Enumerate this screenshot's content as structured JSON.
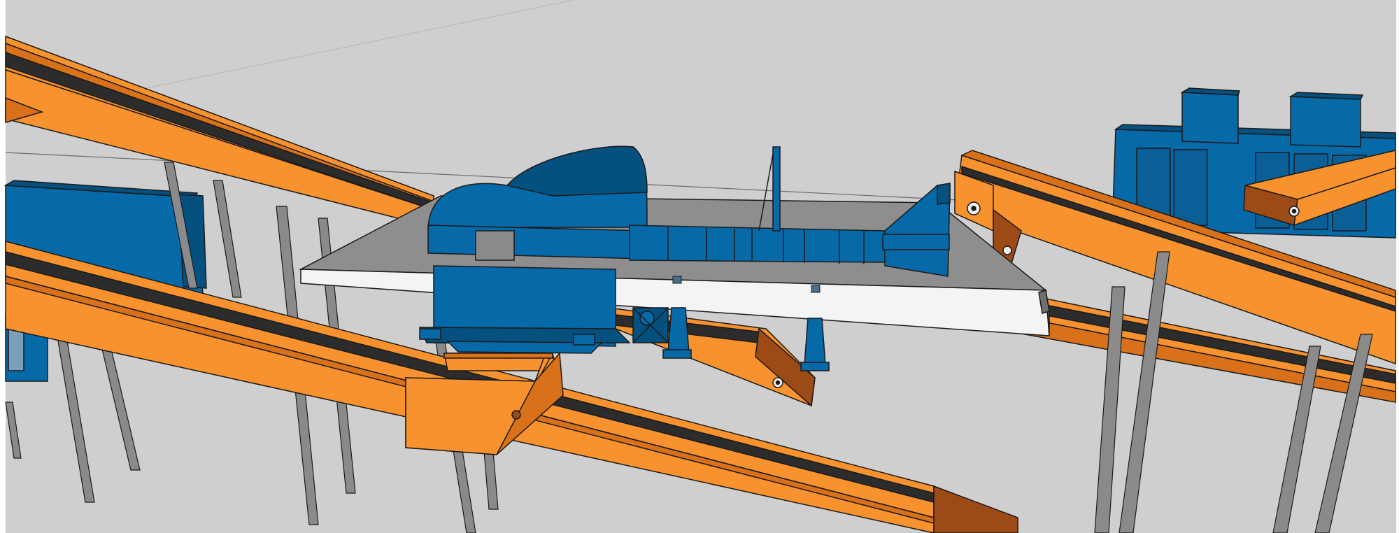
{
  "scene": {
    "kind": "3D render of conveyor belt system with blue processing equipment",
    "colors": {
      "background": "#cfcfcf",
      "conveyor_orange": "#f7922e",
      "conveyor_orange_shade": "#d8711a",
      "conveyor_orange_dark": "#9c4a16",
      "belt_dark": "#2c2c2c",
      "machine_blue": "#0669a8",
      "machine_blue_dark": "#04507f",
      "platform_gray": "#8e8e8e",
      "platform_light": "#f4f4f4",
      "support_gray": "#8a8a8a",
      "outline": "#1a1a1a"
    }
  }
}
